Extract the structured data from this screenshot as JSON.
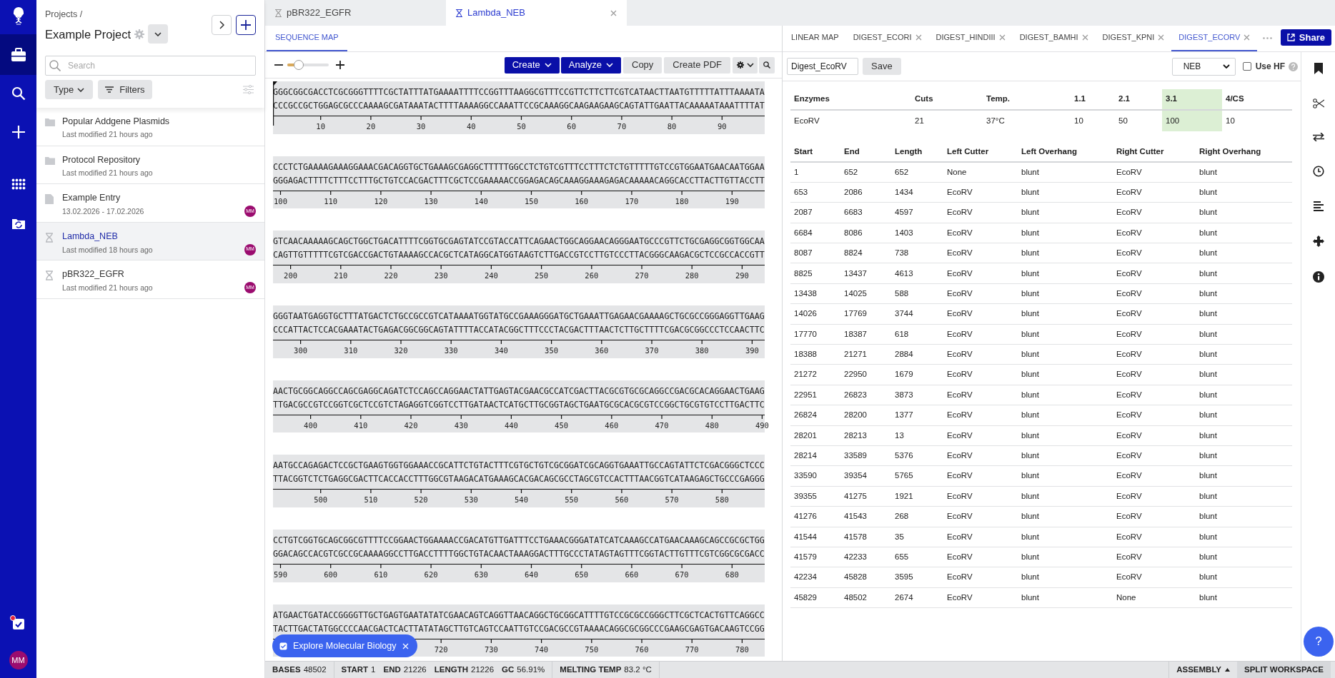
{
  "nav_rail": {
    "items": [
      {
        "selected": false
      },
      {
        "selected": true
      },
      {
        "selected": false
      },
      {
        "selected": false
      },
      {
        "selected": false
      },
      {
        "selected": false
      }
    ],
    "tasks": {
      "notification": true
    },
    "avatar": "MM"
  },
  "project_sidebar": {
    "breadcrumb": "Projects /",
    "title": "Example Project",
    "search": {
      "placeholder": "Search"
    },
    "type_filter": "Type",
    "filters_button": "Filters",
    "entries": [
      {
        "kind": "folder",
        "title": "Popular Addgene Plasmids",
        "subtitle": "Last modified 21 hours ago",
        "selected": false
      },
      {
        "kind": "folder",
        "title": "Protocol Repository",
        "subtitle": "Last modified 21 hours ago",
        "selected": false
      },
      {
        "kind": "entry",
        "title": "Example Entry",
        "subtitle": "13.02.2026 - 17.02.2026",
        "avatar": "MM",
        "selected": false
      },
      {
        "kind": "sequence",
        "title": "Lambda_NEB",
        "subtitle": "Last modified 18 hours ago",
        "avatar": "MM",
        "selected": true
      },
      {
        "kind": "sequence",
        "title": "pBR322_EGFR",
        "subtitle": "Last modified 21 hours ago",
        "avatar": "MM",
        "selected": false
      }
    ]
  },
  "document_tabs": [
    {
      "label": "pBR322_EGFR",
      "selected": false
    },
    {
      "label": "Lambda_NEB",
      "selected": true
    }
  ],
  "sequence_panel": {
    "tabs": [
      {
        "label": "SEQUENCE MAP",
        "selected": true
      }
    ],
    "zoom": {
      "level": 0.27
    },
    "toolbar_buttons": [
      {
        "kind": "primary",
        "label": "Create"
      },
      {
        "kind": "primary",
        "label": "Analyze"
      },
      {
        "kind": "secondary",
        "label": "Copy"
      },
      {
        "kind": "secondary",
        "label": "Create PDF"
      }
    ],
    "blocks": [
      {
        "cursor": true,
        "top": "GGGCGGCGACCTCGCGGGTTTTCGCTATTTATGAAAATTTTCCGGTTTAAGGCGTTTCCGTTCTTCTTCGTCATAACTTAATGTTTTTATTTAAAATA",
        "bottom": "CCCGCCGCTGGAGCGCCCAAAAGCGATAAATACTTTTAAAAGGCCAAATTCCGCAAAGGCAAGAAGAAGCAGTATTGAATTACAAAAATAAATTTTAT",
        "ticks": [
          "10",
          "20",
          "30",
          "40",
          "50",
          "60",
          "70",
          "80",
          "90"
        ]
      },
      {
        "top": "CCCTCTGAAAAGAAAGGAAACGACAGGTGCTGAAAGCGAGGCTTTTTGGCCTCTGTCGTTTCCTTTCTCTGTTTTTGTCCGTGGAATGAACAATGGAA",
        "bottom": "GGGAGACTTTTCTTTCCTTTGCTGTCCACGACTTTCGCTCCGAAAAACCGGAGACAGCAAAGGAAAGAGACAAAAACAGGCACCTTACTTGTTACCTT",
        "ticks": [
          "100",
          "110",
          "120",
          "130",
          "140",
          "150",
          "160",
          "170",
          "180",
          "190"
        ]
      },
      {
        "top": "GTCAACAAAAAGCAGCTGGCTGACATTTTCGGTGCGAGTATCCGTACCATTCAGAACTGGCAGGAACAGGGAATGCCCGTTCTGCGAGGCGGTGGCAA",
        "bottom": "CAGTTGTTTTTCGTCGACCGACTGTAAAAGCCACGCTCATAGGCATGGTAAGTCTTGACCGTCCTTGTCCCTTACGGGCAAGACGCTCCGCCACCGTT",
        "ticks": [
          "200",
          "210",
          "220",
          "230",
          "240",
          "250",
          "260",
          "270",
          "280",
          "290"
        ]
      },
      {
        "top": "GGGTAATGAGGTGCTTTATGACTCTGCCGCCGTCATAAAATGGTATGCCGAAAGGGATGCTGAAATTGAGAACGAAAAGCTGCGCCGGGAGGTTGAAG",
        "bottom": "CCCATTACTCCACGAAATACTGAGACGGCGGCAGTATTTTACCATACGGCTTTCCCTACGACTTTAACTCTTGCTTTTCGACGCGGCCCTCCAACTTC",
        "ticks": [
          "300",
          "310",
          "320",
          "330",
          "340",
          "350",
          "360",
          "370",
          "380",
          "390"
        ]
      },
      {
        "top": "AACTGCGGCAGGCCAGCGAGGCAGATCTCCAGCCAGGAACTATTGAGTACGAACGCCATCGACTTACGCGTGCGCAGGCCGACGCACAGGAACTGAAG",
        "bottom": "TTGACGCCGTCCGGTCGCTCCGTCTAGAGGTCGGTCCTTGATAACTCATGCTTGCGGTAGCTGAATGCGCACGCGTCCGGCTGCGTGTCCTTGACTTC",
        "ticks": [
          "400",
          "410",
          "420",
          "430",
          "440",
          "450",
          "460",
          "470",
          "480",
          "490"
        ]
      },
      {
        "top": "AATGCCAGAGACTCCGCTGAAGTGGTGGAAACCGCATTCTGTACTTTCGTGCTGTCGCGGATCGCAGGTGAAATTGCCAGTATTCTCGACGGGCTCCC",
        "bottom": "TTACGGTCTCTGAGGCGACTTCACCACCTTTGGCGTAAGACATGAAAGCACGACAGCGCCTAGCGTCCACTTTAACGGTCATAAGAGCTGCCCGAGGG",
        "ticks": [
          "500",
          "510",
          "520",
          "530",
          "540",
          "550",
          "560",
          "570",
          "580"
        ]
      },
      {
        "top": "CCTGTCGGTGCAGCGGCGTTTTCCGGAACTGGAAAACCGACATGTTGATTTCCTGAAACGGGATATCATCAAAGCCATGAACAAAGCAGCCGCGCTGG",
        "bottom": "GGACAGCCACGTCGCCGCAAAAGGCCTTGACCTTTTGGCTGTACAACTAAAGGACTTTGCCCTATAGTAGTTTCGGTACTTGTTTCGTCGGCGCGACC",
        "ticks": [
          "590",
          "600",
          "610",
          "620",
          "630",
          "640",
          "650",
          "660",
          "670",
          "680"
        ]
      },
      {
        "top": "ATGAACTGATACCGGGGTTGCTGAGTGAATATATCGAACAGTCAGGTTAACAGGCTGCGGCATTTTGTCCGCGCCGGGCTTCGCTCACTGTTCAGGCC",
        "bottom": "TACTTGACTATGGCCCCAACGACTCACTTATATAGCTTGTCAGTCCAATTGTCCGACGCCGTAAAACAGGCGCGGCCCGAAGCGAGTGACAAGTCCGG",
        "ticks": [
          "720",
          "730",
          "740",
          "750",
          "760",
          "770",
          "780"
        ]
      }
    ],
    "explore_chip": "Explore Molecular Biology"
  },
  "analysis_panel": {
    "tabs": [
      {
        "label": "LINEAR MAP",
        "closable": false,
        "selected": false
      },
      {
        "label": "DIGEST_ECORI",
        "closable": true,
        "selected": false
      },
      {
        "label": "DIGEST_HINDIII",
        "closable": true,
        "selected": false
      },
      {
        "label": "DIGEST_BAMHI",
        "closable": true,
        "selected": false
      },
      {
        "label": "DIGEST_KPNI",
        "closable": true,
        "selected": false
      },
      {
        "label": "DIGEST_ECORV",
        "closable": true,
        "selected": true
      }
    ],
    "share_button": "Share",
    "digest_name": "Digest_EcoRV",
    "save_button": "Save",
    "buffer_select": "NEB",
    "use_hf": {
      "label": "Use HF",
      "checked": false
    },
    "enzyme_table": {
      "columns": [
        {
          "label": "Enzymes",
          "highlighted": false
        },
        {
          "label": "Cuts",
          "highlighted": false
        },
        {
          "label": "Temp.",
          "highlighted": false
        },
        {
          "label": "1.1",
          "highlighted": false
        },
        {
          "label": "2.1",
          "highlighted": false
        },
        {
          "label": "3.1",
          "highlighted": true
        },
        {
          "label": "4/CS",
          "highlighted": false
        }
      ],
      "rows": [
        [
          "EcoRV",
          "21",
          "37°C",
          "10",
          "50",
          "100",
          "10"
        ]
      ]
    },
    "fragment_table": {
      "columns": [
        "Start",
        "End",
        "Length",
        "Left Cutter",
        "Left Overhang",
        "Right Cutter",
        "Right Overhang"
      ],
      "rows": [
        [
          "1",
          "652",
          "652",
          "None",
          "blunt",
          "EcoRV",
          "blunt"
        ],
        [
          "653",
          "2086",
          "1434",
          "EcoRV",
          "blunt",
          "EcoRV",
          "blunt"
        ],
        [
          "2087",
          "6683",
          "4597",
          "EcoRV",
          "blunt",
          "EcoRV",
          "blunt"
        ],
        [
          "6684",
          "8086",
          "1403",
          "EcoRV",
          "blunt",
          "EcoRV",
          "blunt"
        ],
        [
          "8087",
          "8824",
          "738",
          "EcoRV",
          "blunt",
          "EcoRV",
          "blunt"
        ],
        [
          "8825",
          "13437",
          "4613",
          "EcoRV",
          "blunt",
          "EcoRV",
          "blunt"
        ],
        [
          "13438",
          "14025",
          "588",
          "EcoRV",
          "blunt",
          "EcoRV",
          "blunt"
        ],
        [
          "14026",
          "17769",
          "3744",
          "EcoRV",
          "blunt",
          "EcoRV",
          "blunt"
        ],
        [
          "17770",
          "18387",
          "618",
          "EcoRV",
          "blunt",
          "EcoRV",
          "blunt"
        ],
        [
          "18388",
          "21271",
          "2884",
          "EcoRV",
          "blunt",
          "EcoRV",
          "blunt"
        ],
        [
          "21272",
          "22950",
          "1679",
          "EcoRV",
          "blunt",
          "EcoRV",
          "blunt"
        ],
        [
          "22951",
          "26823",
          "3873",
          "EcoRV",
          "blunt",
          "EcoRV",
          "blunt"
        ],
        [
          "26824",
          "28200",
          "1377",
          "EcoRV",
          "blunt",
          "EcoRV",
          "blunt"
        ],
        [
          "28201",
          "28213",
          "13",
          "EcoRV",
          "blunt",
          "EcoRV",
          "blunt"
        ],
        [
          "28214",
          "33589",
          "5376",
          "EcoRV",
          "blunt",
          "EcoRV",
          "blunt"
        ],
        [
          "33590",
          "39354",
          "5765",
          "EcoRV",
          "blunt",
          "EcoRV",
          "blunt"
        ],
        [
          "39355",
          "41275",
          "1921",
          "EcoRV",
          "blunt",
          "EcoRV",
          "blunt"
        ],
        [
          "41276",
          "41543",
          "268",
          "EcoRV",
          "blunt",
          "EcoRV",
          "blunt"
        ],
        [
          "41544",
          "41578",
          "35",
          "EcoRV",
          "blunt",
          "EcoRV",
          "blunt"
        ],
        [
          "41579",
          "42233",
          "655",
          "EcoRV",
          "blunt",
          "EcoRV",
          "blunt"
        ],
        [
          "42234",
          "45828",
          "3595",
          "EcoRV",
          "blunt",
          "EcoRV",
          "blunt"
        ],
        [
          "45829",
          "48502",
          "2674",
          "EcoRV",
          "blunt",
          "None",
          "blunt"
        ]
      ]
    },
    "help_button": "?"
  },
  "status_bar": {
    "groups": [
      [
        {
          "label": "BASES",
          "value": "48502"
        }
      ],
      [
        {
          "label": "START",
          "value": "1"
        },
        {
          "label": "END",
          "value": "21226"
        },
        {
          "label": "LENGTH",
          "value": "21226"
        },
        {
          "label": "GC",
          "value": "56.91%"
        }
      ],
      [
        {
          "label": "MELTING TEMP",
          "value": "83.2 °C"
        }
      ]
    ],
    "assembly_button": "ASSEMBLY",
    "split_button": "SPLIT WORKSPACE"
  }
}
